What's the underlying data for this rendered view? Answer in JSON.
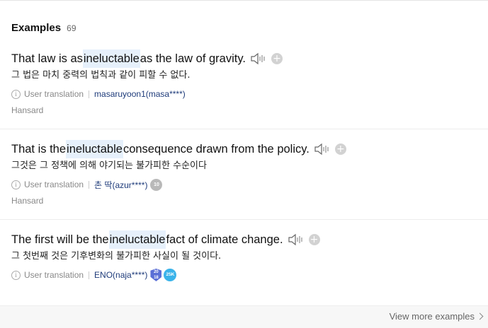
{
  "header": {
    "title": "Examples",
    "count": "69"
  },
  "examples": [
    {
      "before": "That law is as ",
      "highlight": "ineluctable",
      "after": " as the law of gravity.",
      "translation": "그 법은 마치 중력의 법칙과 같이 피할 수 없다.",
      "meta_label": "User translation",
      "user": "masaruyoon1(masa****)",
      "source": "Hansard"
    },
    {
      "before": "That is the ",
      "highlight": "ineluctable",
      "after": " consequence drawn from the policy.",
      "translation": "그것은 그 정책에 의해 야기되는 불가피한 수순이다",
      "meta_label": "User translation",
      "user": "촌 딱(azur****)",
      "badge": "10",
      "source": "Hansard"
    },
    {
      "before": "The first will be the ",
      "highlight": "ineluctable",
      "after": " fact of climate change.",
      "translation": "그 첫번째 것은 기후변화의 불가피한 사실이 될 것이다.",
      "meta_label": "User translation",
      "user": "ENO(naja****)",
      "badge_year_top": "20",
      "badge_year_bottom": "18",
      "badge_count": "25K"
    }
  ],
  "footer": {
    "view_more": "View more examples"
  },
  "colors": {
    "highlight": "#e6f0fb",
    "user_link": "#1e3b7a",
    "badge_blue": "#3ab3ea",
    "badge_shield": "#5b6fd6"
  }
}
